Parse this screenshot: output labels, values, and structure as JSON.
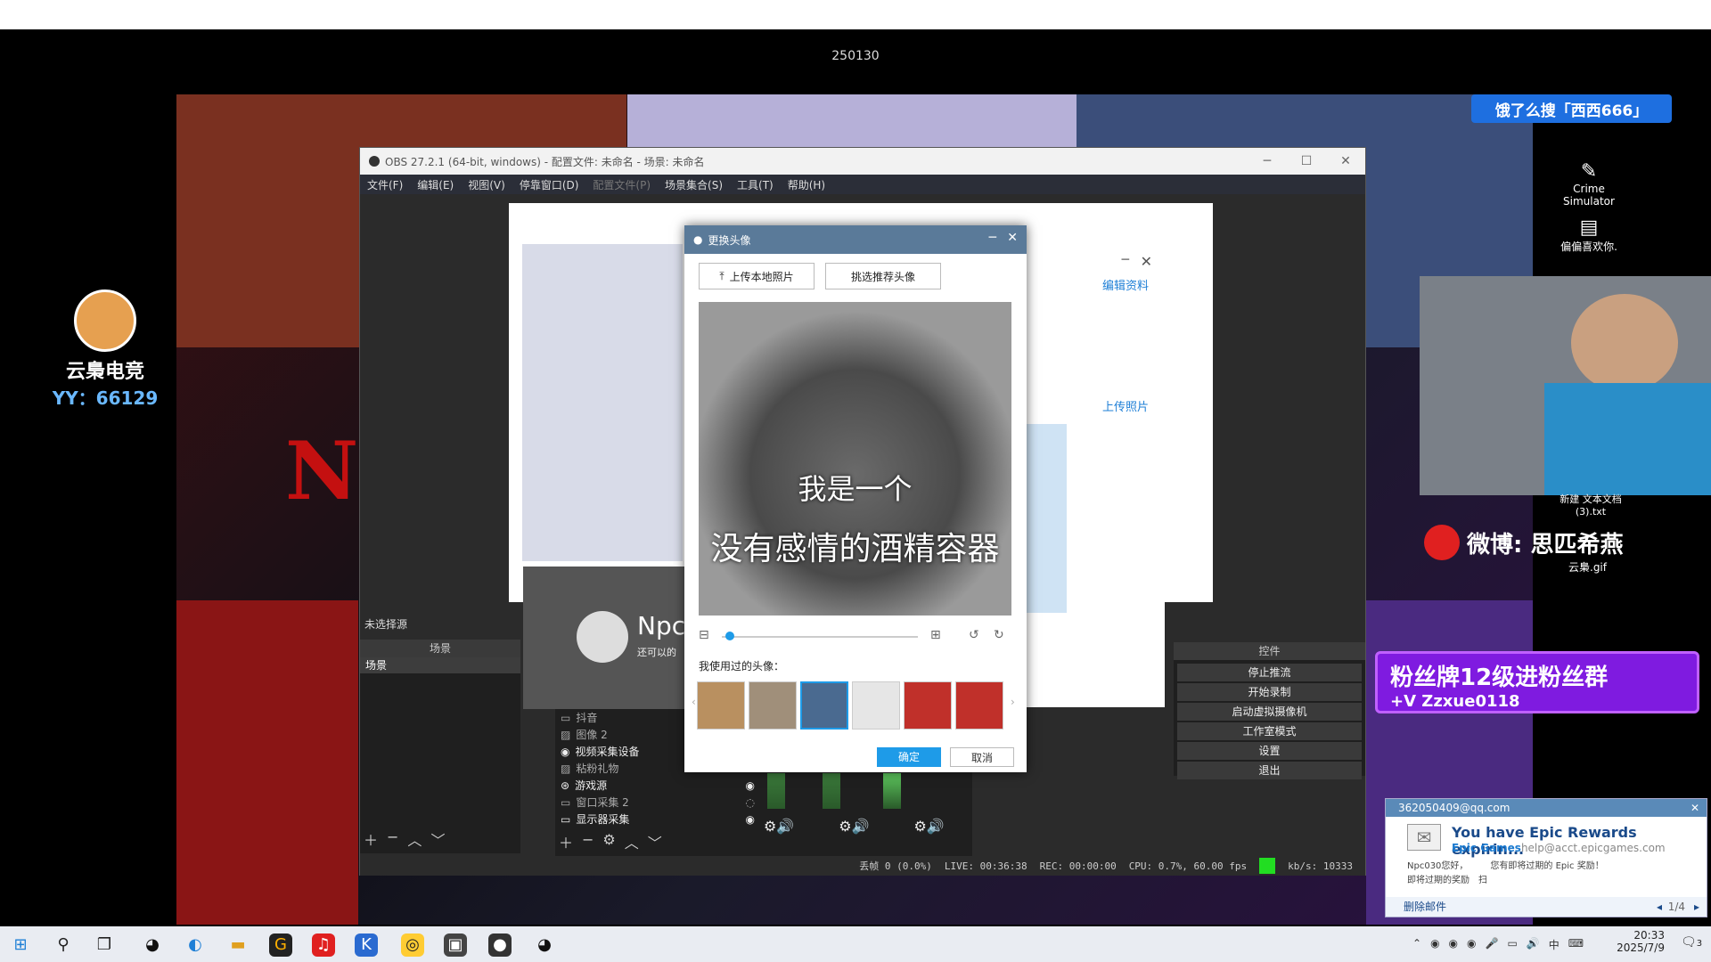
{
  "stream_id": "250130",
  "search_badge": "饿了么搜「西西666」",
  "streamer_logo": {
    "name": "云梟电竞",
    "yy": "YY：66129"
  },
  "obs": {
    "title": "OBS 27.2.1 (64-bit, windows) - 配置文件: 未命名 - 场景: 未命名",
    "menu": [
      "文件(F)",
      "编辑(E)",
      "视图(V)",
      "停靠窗口(D)",
      "配置文件(P)",
      "场景集合(S)",
      "工具(T)",
      "帮助(H)"
    ],
    "no_source": "未选择源",
    "scenes_header": "场景",
    "scene_item": "场景",
    "sources": [
      {
        "label": "抖音",
        "active": false
      },
      {
        "label": "图像 2",
        "active": false
      },
      {
        "label": "视频采集设备",
        "active": true
      },
      {
        "label": "粘粉礼物",
        "active": false
      },
      {
        "label": "游戏源",
        "active": true
      },
      {
        "label": "窗口采集 2",
        "active": false
      },
      {
        "label": "显示器采集",
        "active": true
      }
    ],
    "controls_header": "控件",
    "controls": [
      "停止推流",
      "开始录制",
      "启动虚拟摄像机",
      "工作室模式",
      "设置",
      "退出"
    ],
    "status": {
      "dropped": "丢帧 0 (0.0%)",
      "live": "LIVE: 00:36:38",
      "rec": "REC: 00:00:00",
      "cpu": "CPU: 0.7%, 60.00 fps",
      "kbps": "kb/s: 10333"
    }
  },
  "qq_profile": {
    "edit": "编辑资料",
    "upload": "上传照片"
  },
  "qq_chat": {
    "name": "Npc",
    "status": "还可以的"
  },
  "avatar_dialog": {
    "title": "更换头像",
    "upload_local": "上传本地照片",
    "pick_recommended": "挑选推荐头像",
    "caption_line1": "我是一个",
    "caption_line2": "没有感情的酒精容器",
    "history_label": "我使用过的头像：",
    "confirm": "确定",
    "cancel": "取消",
    "zoom_level": 0.02
  },
  "desktop_icons": [
    {
      "label": "Crime Simulator",
      "icon": "game-icon"
    },
    {
      "label": "偏偏喜欢你.",
      "icon": "document-icon"
    },
    {
      "label": "新建 文本文档 (3).txt",
      "icon": "text-file-icon"
    },
    {
      "label": "云梟.gif",
      "icon": "image-file-icon"
    }
  ],
  "weibo": "微博: 思匹希燕",
  "fans_banner": {
    "line1": "粉丝牌12级进粉丝群",
    "line2": "+V Zzxue0118"
  },
  "mail": {
    "account": "362050409@qq.com",
    "subject": "You have Epic Rewards expirin...",
    "sender": "Epic Games",
    "sender_addr": "help@acct.epicgames.com",
    "preview1": "Npc030您好，　　　您有即将过期的 Epic 奖励！",
    "preview2": "即将过期的奖励　扫",
    "delete": "删除邮件",
    "page": "1/4"
  },
  "taskbar": {
    "time": "20:33",
    "date": "2025/7/9",
    "ime": "中",
    "notif_count": "3"
  },
  "colors": {
    "obs_bg": "#2b2b2b",
    "dialog_title": "#5a7a99",
    "confirm": "#1e9be8",
    "banner": "#7f1be0",
    "live_green": "#22dd22"
  }
}
